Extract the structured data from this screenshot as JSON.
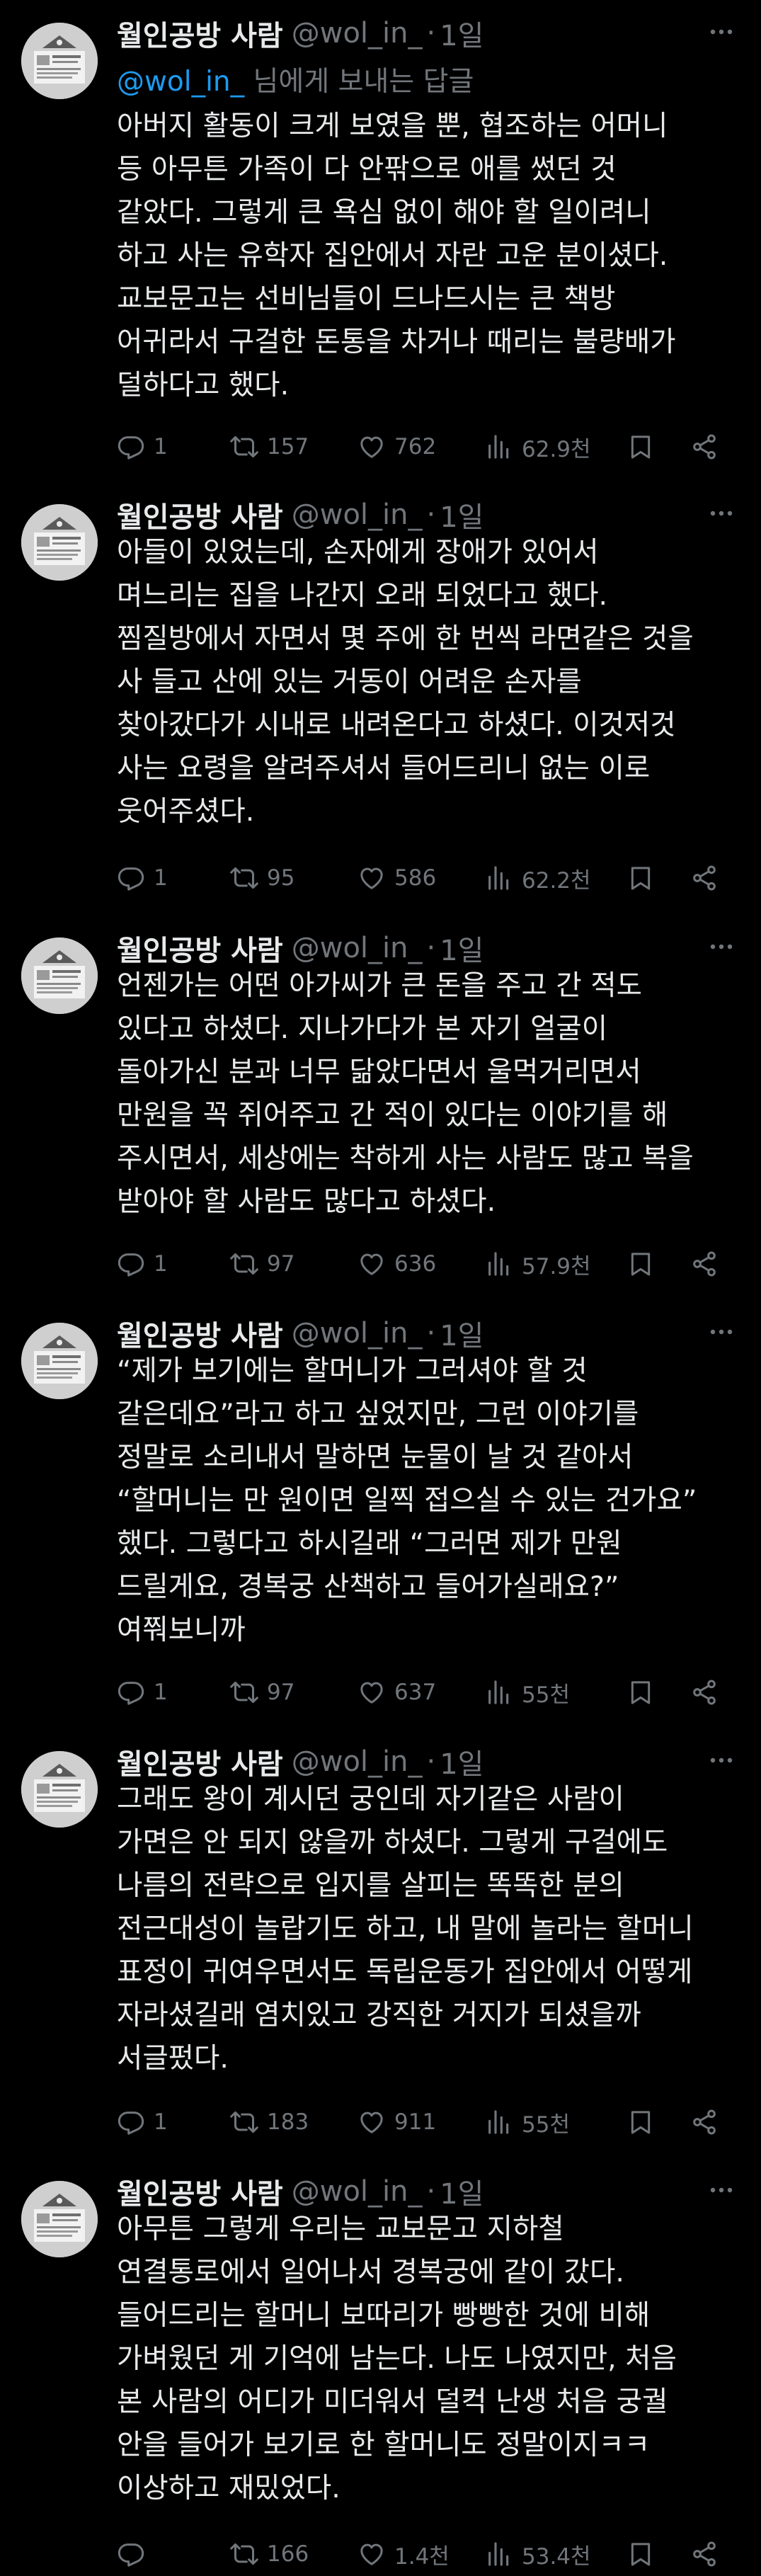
{
  "author": {
    "name": "월인공방 사람",
    "handle": "@wol_in_",
    "dot": "·",
    "time": "1일"
  },
  "reply_context": {
    "mention": "@wol_in_",
    "suffix": " 님에게 보내는 답글"
  },
  "icons": {
    "reply": "reply-icon",
    "retweet": "retweet-icon",
    "like": "heart-icon",
    "views": "views-icon",
    "bookmark": "bookmark-icon",
    "share": "share-icon",
    "more": "more-icon"
  },
  "colors": {
    "background": "#000000",
    "text": "#e7e9ea",
    "muted": "#71767b",
    "link": "#1d9bf0"
  },
  "tweets": [
    {
      "text": "아버지 활동이 크게 보였을 뿐, 협조하는 어머니\n등 아무튼 가족이 다 안팎으로 애를 썼던 것\n같았다. 그렇게 큰 욕심 없이 해야 할 일이려니\n하고 사는 유학자 집안에서 자란 고운 분이셨다.\n교보문고는 선비님들이 드나드시는 큰 책방\n어귀라서 구걸한 돈통을 차거나 때리는 불량배가\n덜하다고 했다.",
      "replies": "1",
      "retweets": "157",
      "likes": "762",
      "views": "62.9천"
    },
    {
      "text": "아들이 있었는데, 손자에게 장애가 있어서\n며느리는 집을 나간지 오래 되었다고 했다.\n찜질방에서 자면서 몇 주에 한 번씩 라면같은 것을\n사 들고 산에 있는 거동이 어려운 손자를\n찾아갔다가 시내로 내려온다고 하셨다. 이것저것\n사는 요령을 알려주셔서 들어드리니 없는 이로\n웃어주셨다.",
      "replies": "1",
      "retweets": "95",
      "likes": "586",
      "views": "62.2천"
    },
    {
      "text": "언젠가는 어떤 아가씨가 큰 돈을 주고 간 적도\n있다고 하셨다. 지나가다가 본 자기 얼굴이\n돌아가신 분과 너무 닮았다면서 울먹거리면서\n만원을 꼭 쥐어주고 간 적이 있다는 이야기를 해\n주시면서, 세상에는 착하게 사는 사람도 많고 복을\n받아야 할 사람도 많다고 하셨다.",
      "replies": "1",
      "retweets": "97",
      "likes": "636",
      "views": "57.9천"
    },
    {
      "text": "“제가 보기에는 할머니가 그러셔야 할 것\n같은데요”라고 하고 싶었지만, 그런 이야기를\n정말로 소리내서 말하면 눈물이 날 것 같아서\n“할머니는 만 원이면 일찍 접으실 수 있는 건가요”\n했다. 그렇다고 하시길래 “그러면 제가 만원\n드릴게요, 경복궁 산책하고 들어가실래요?”\n여쭤보니까",
      "replies": "1",
      "retweets": "97",
      "likes": "637",
      "views": "55천"
    },
    {
      "text": "그래도 왕이 계시던 궁인데 자기같은 사람이\n가면은 안 되지 않을까 하셨다. 그렇게 구걸에도\n나름의 전략으로 입지를 살피는 똑똑한 분의\n전근대성이 놀랍기도 하고, 내 말에 놀라는 할머니\n표정이 귀여우면서도 독립운동가 집안에서 어떻게\n자라셨길래 염치있고 강직한 거지가 되셨을까\n서글펐다.",
      "replies": "1",
      "retweets": "183",
      "likes": "911",
      "views": "55천"
    },
    {
      "text": "아무튼 그렇게 우리는 교보문고 지하철\n연결통로에서 일어나서 경복궁에 같이 갔다.\n들어드리는 할머니 보따리가 빵빵한 것에 비해\n가벼웠던 게 기억에 남는다. 나도 나였지만, 처음\n본 사람의 어디가 미더워서 덜컥 난생 처음 궁궐\n안을 들어가 보기로 한 할머니도 정말이지ㅋㅋ\n이상하고 재밌었다.",
      "replies": "",
      "retweets": "166",
      "likes": "1.4천",
      "views": "53.4천"
    }
  ]
}
